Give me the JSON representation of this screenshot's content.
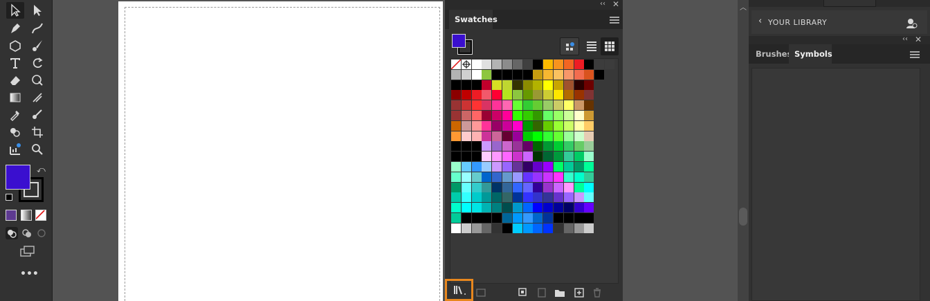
{
  "swatches_panel": {
    "tab_label": "Swatches",
    "fill_color": "#3a0fcf",
    "stroke_color": "#000000"
  },
  "library_panel": {
    "title": "YOUR LIBRARY"
  },
  "brushes_symbols_panel": {
    "tabs": [
      "Brushes",
      "Symbols"
    ]
  },
  "toolbar": {
    "fill_color": "#3a0fcf",
    "more_label": "•••"
  },
  "colors": {
    "highlight": "#e8871e",
    "panel_bg": "#323232"
  },
  "swatch_rows": [
    [
      "none",
      "reg",
      "#ffffff",
      "#e0e0e0",
      "#b3b3b3",
      "#8c8c8c",
      "#666666",
      "#404040",
      "#000000",
      "#fbb900",
      "#f7931e",
      "#f26522",
      "#ed1c24",
      "#000000",
      "#3c3c3c",
      "#3c3c3c"
    ],
    [
      "#b3b3b3",
      "#d0d0d0",
      "#ffffff",
      "#8dc63f",
      "#000000",
      "#000000",
      "#000000",
      "#000000",
      "#c69c10",
      "#f7b731",
      "#fbc160",
      "#f7976a",
      "#f26c4f",
      "#d9531e",
      "#000000"
    ],
    [
      "#000000",
      "#000000",
      "#000000",
      "#c1002b",
      "#d7df23",
      "#bfd730",
      "#333300",
      "#8b8b00",
      "#b2b200",
      "#ffff00",
      "#c8a600",
      "#a0522d",
      "#2b0000",
      "#6d0000"
    ],
    [
      "#8b0000",
      "#c00000",
      "#ee1c25",
      "#f1596b",
      "#ff0033",
      "#b4e31e",
      "#8cc63f",
      "#669900",
      "#999933",
      "#cccc33",
      "#ffe600",
      "#b36b00",
      "#993300",
      "#803333"
    ],
    [
      "#993333",
      "#cc3333",
      "#ff3333",
      "#d93363",
      "#ff3399",
      "#ff66b2",
      "#66ff33",
      "#33cc33",
      "#66cc33",
      "#99cc66",
      "#cccc66",
      "#ffff66",
      "#cc9966",
      "#663300"
    ],
    [
      "#993333",
      "#cc6666",
      "#ff6666",
      "#990033",
      "#cc0066",
      "#ff0099",
      "#33ff00",
      "#33cc00",
      "#339900",
      "#66ff66",
      "#99ff66",
      "#ccff99",
      "#ffffcc",
      "#cc9933"
    ],
    [
      "#cc6600",
      "#cc9999",
      "#ff9999",
      "#ff3399",
      "#990066",
      "#cc0099",
      "#ff00cc",
      "#009900",
      "#336600",
      "#66cc00",
      "#99ff33",
      "#ccff66",
      "#ffffaa",
      "#ffcc66"
    ],
    [
      "#ff9933",
      "#ffcccc",
      "#ffb3b3",
      "#cc3399",
      "#cc6699",
      "#660033",
      "#990099",
      "#00cc00",
      "#00ff00",
      "#33ff33",
      "#66ff33",
      "#99ff99",
      "#ccffcc",
      "#e6ccb3"
    ],
    [
      "#000000",
      "#000000",
      "#000000",
      "#cc99ff",
      "#9966cc",
      "#cc66cc",
      "#993399",
      "#660066",
      "#006600",
      "#009933",
      "#00cc33",
      "#33cc66",
      "#66cc66",
      "#99cc99"
    ],
    [
      "#000000",
      "#000000",
      "#000000",
      "#ffccff",
      "#ff99ff",
      "#ff66ff",
      "#cc33cc",
      "#cc66ff",
      "#003300",
      "#006633",
      "#00993c",
      "#33cc99",
      "#00cc66",
      "#99ffcc"
    ],
    [
      "#99ffcc",
      "#66ccff",
      "#3399ff",
      "#99ccff",
      "#cc99ff",
      "#9966ff",
      "#663399",
      "#330066",
      "#6600cc",
      "#9900ff",
      "#00ff66",
      "#00cc99",
      "#009966",
      "#00ff99"
    ],
    [
      "#66ffcc",
      "#99ffff",
      "#66cccc",
      "#0066cc",
      "#3366cc",
      "#6699cc",
      "#9999ff",
      "#6633ff",
      "#9933ff",
      "#cc33ff",
      "#ff33ff",
      "#33ffcc",
      "#00ffcc",
      "#33cc99"
    ],
    [
      "#009966",
      "#66ffff",
      "#33cccc",
      "#339999",
      "#003366",
      "#336699",
      "#3366ff",
      "#6666ff",
      "#330099",
      "#9933cc",
      "#cc66ff",
      "#ff99ff",
      "#00ff99",
      "#00ffff"
    ],
    [
      "#00ccaa",
      "#33ffff",
      "#00cccc",
      "#009999",
      "#006666",
      "#336666",
      "#003399",
      "#3333ff",
      "#3333cc",
      "#333399",
      "#6633cc",
      "#9966ff",
      "#cc99ff",
      "#66ffff"
    ],
    [
      "#00ffcc",
      "#00ffff",
      "#00e5e5",
      "#00b3b3",
      "#008080",
      "#004d4d",
      "#0099cc",
      "#0066ff",
      "#0000ff",
      "#0000cc",
      "#000099",
      "#000066",
      "#3300cc",
      "#6600ff"
    ],
    [
      "#00cc99",
      "#000000",
      "#000000",
      "#000000",
      "#000000",
      "#006699",
      "#0099ff",
      "#3399ff",
      "#0066cc",
      "#003399",
      "#000000",
      "#000000",
      "#000000",
      "#000000"
    ],
    [
      "#ffffff",
      "#cccccc",
      "#999999",
      "#666666",
      "#333333",
      "#000000",
      "#00ccff",
      "#0099ff",
      "#0066ff",
      "#0033ff",
      "#333333",
      "#666666",
      "#999999",
      "#cccccc"
    ]
  ]
}
